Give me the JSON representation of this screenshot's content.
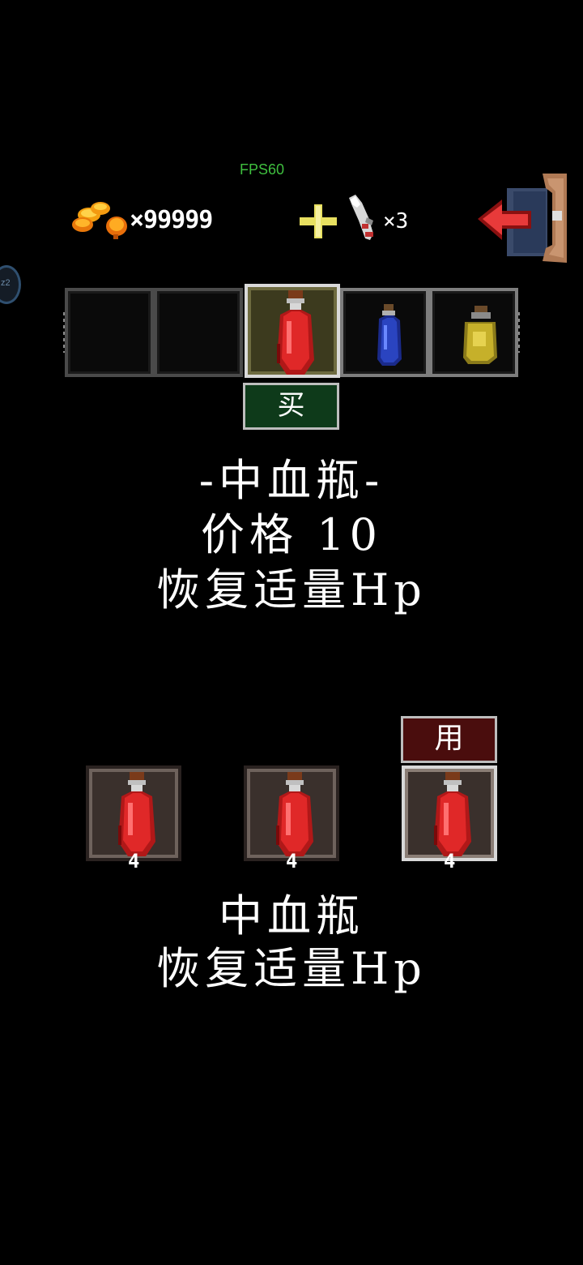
{
  "hud": {
    "fps": "FPS60",
    "coin_count": "×99999",
    "key_count": "×3"
  },
  "shop": {
    "slots": [
      {
        "item": "empty"
      },
      {
        "item": "empty"
      },
      {
        "item": "red-potion-icon",
        "selected": true
      },
      {
        "item": "blue-potion-icon"
      },
      {
        "item": "yellow-potion-icon"
      }
    ],
    "buy_label": "买",
    "item_name": "-中血瓶-",
    "item_price": "价格 10",
    "item_desc": "恢复适量Hp"
  },
  "inventory": {
    "use_label": "用",
    "slots": [
      {
        "item": "red-potion-icon",
        "count": "4"
      },
      {
        "item": "red-potion-icon",
        "count": "4"
      },
      {
        "item": "red-potion-icon",
        "count": "4",
        "selected": true
      }
    ],
    "item_name": "中血瓶",
    "item_desc": "恢复适量Hp"
  },
  "colors": {
    "buy_bg": "#0e3a1a",
    "use_bg": "#4a0d0d",
    "fps_color": "#3fbf3f"
  }
}
